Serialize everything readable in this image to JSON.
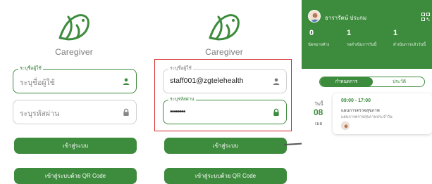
{
  "colors": {
    "primary": "#3d8b3d",
    "highlight": "#d62828",
    "text": "#333333"
  },
  "login_empty": {
    "brand": "Caregiver",
    "username": {
      "label": "ระบุชื่อผู้ใช้",
      "placeholder": "ระบุชื่อผู้ใช้",
      "icon": "person-icon"
    },
    "password": {
      "placeholder": "ระบุรหัสผ่าน",
      "icon": "lock-icon"
    },
    "login_button": "เข้าสู่ระบบ",
    "qr_button": "เข้าสู่ระบบด้วย QR Code"
  },
  "login_filled": {
    "brand": "Caregiver",
    "username": {
      "label": "ระบุชื่อผู้ใช้",
      "value": "staff001@zgtelehealth",
      "icon": "person-icon"
    },
    "password": {
      "label": "ระบุรหัสผ่าน",
      "value": "••••••••",
      "icon": "lock-icon"
    },
    "login_button": "เข้าสู่ระบบ",
    "qr_button": "เข้าสู่ระบบด้วย QR Code"
  },
  "dashboard": {
    "user_name": "ธารารัตน์ ประกม",
    "stats": [
      {
        "value": "0",
        "label": "นัดหมายค้าง"
      },
      {
        "value": "1",
        "label": "รอดำเนินการวันนี้"
      },
      {
        "value": "1",
        "label": "ดำเนินการแล้ววันนี้"
      }
    ],
    "tabs": [
      "กำหนดการ",
      "ประวัติ"
    ],
    "date": {
      "day_label": "วันนี้",
      "day": "08",
      "month": "เมย"
    },
    "appointment": {
      "time": "09:00 - 17:00",
      "title": "แผนการตรวจสุขภาพ",
      "subtitle": "แผนการตรวจสุขภาพประจำวัน"
    }
  }
}
